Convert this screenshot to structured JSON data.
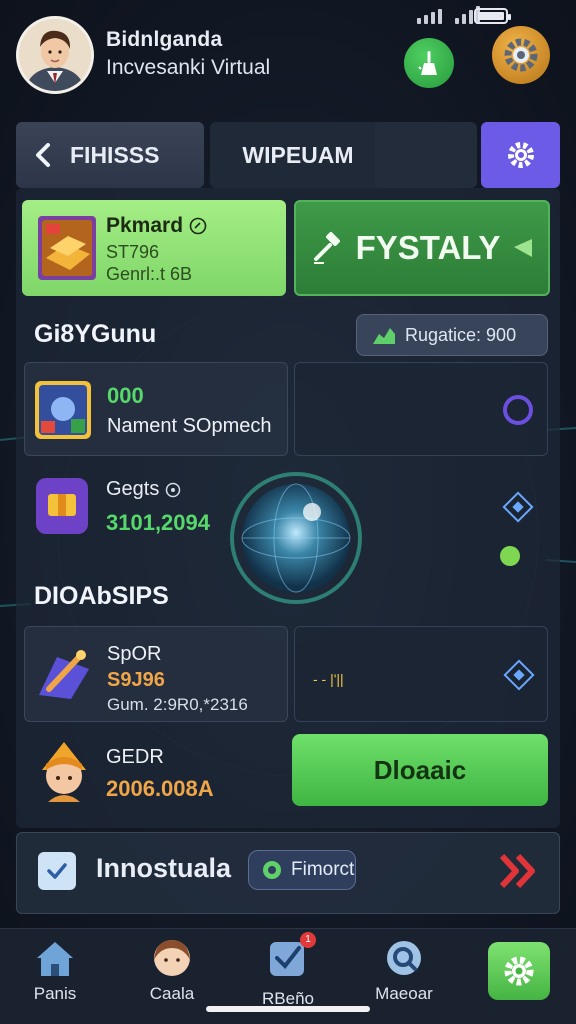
{
  "header": {
    "name": "Bidnlganda",
    "subtitle": "Incvesanki Virtual"
  },
  "tabs": {
    "back_label": "FIHISSS",
    "mid_label": "WIPEUAM"
  },
  "promo": {
    "title": "Pkmard",
    "line1": "ST796",
    "line2": "Genrl:.t 6B",
    "cta_label": "FYSTALY"
  },
  "section1": {
    "title": "Gi8YGunu",
    "pill_label": "Rugatice: 900"
  },
  "items": [
    {
      "amount": "000",
      "label": "Nament SOpmech"
    },
    {
      "title": "Gegts",
      "amount": "3101,2094"
    }
  ],
  "section2": {
    "title": "DIOAbSIPS"
  },
  "items2": [
    {
      "title": "SpOR",
      "amount": "S9J96",
      "label": "Gum. 2:9R0,*2316",
      "mini": "- - |'||"
    },
    {
      "title": "GEDR",
      "amount": "2006.008A",
      "button": "Dloaaic"
    }
  ],
  "footer_card": {
    "text": "Innostuala",
    "pill": "Fimorct"
  },
  "nav": [
    {
      "label": "Panis",
      "icon": "home-icon"
    },
    {
      "label": "Caala",
      "icon": "avatar-icon"
    },
    {
      "label": "RBeño",
      "icon": "check-icon",
      "badge": "1"
    },
    {
      "label": "Maeoar",
      "icon": "search-icon"
    },
    {
      "label": "",
      "icon": "gear-icon"
    }
  ],
  "colors": {
    "accent_purple": "#6b5be6",
    "accent_green": "#57d86b",
    "accent_orange": "#f0a648",
    "alert_red": "#e03438"
  }
}
